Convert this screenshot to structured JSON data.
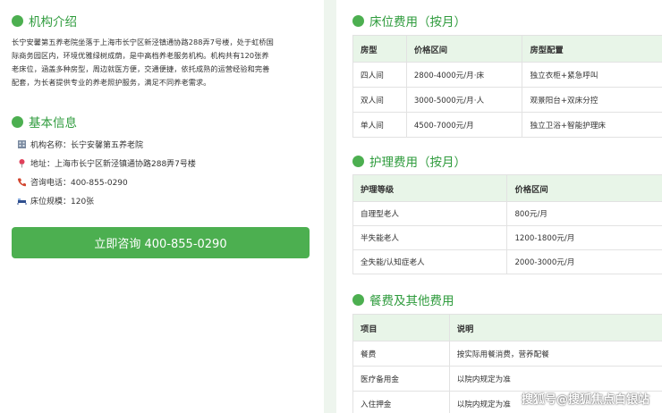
{
  "left": {
    "intro_section": {
      "title": "机构介绍",
      "lines": [
        "长宁安馨第五养老院坐落于上海市长宁区新泾镇通协路288弄7号楼，处于虹桥国",
        "际商务园区内，环境优雅绿树成荫，是中高档养老服务机构。机构共有120张养",
        "老床位，涵盖多种房型，周边就医方便，交通便捷，依托成熟的运营经验和完善",
        "配套，为长者提供专业的养老照护服务，满足不同养老需求。"
      ]
    },
    "basic_section": {
      "title": "基本信息",
      "rows": [
        {
          "icon": "building-icon",
          "text": "机构名称：长宁安馨第五养老院"
        },
        {
          "icon": "location-pin-icon",
          "text": "地址：上海市长宁区新泾镇通协路288弄7号楼"
        },
        {
          "icon": "phone-icon",
          "text": "咨询电话：400-855-0290"
        },
        {
          "icon": "bed-icon",
          "text": "床位规模：120张"
        }
      ]
    },
    "cta_label": "立即咨询 400-855-0290"
  },
  "right": {
    "bed_fees": {
      "title": "床位费用（按月）",
      "headers": [
        "房型",
        "价格区间",
        "房型配置"
      ],
      "rows": [
        [
          "四人间",
          "2800-4000元/月·床",
          "独立衣柜+紧急呼叫"
        ],
        [
          "双人间",
          "3000-5000元/月·人",
          "观景阳台+双床分控"
        ],
        [
          "单人间",
          "4500-7000元/月",
          "独立卫浴+智能护理床"
        ]
      ]
    },
    "care_fees": {
      "title": "护理费用（按月）",
      "headers": [
        "护理等级",
        "价格区间"
      ],
      "rows": [
        [
          "自理型老人",
          "800元/月"
        ],
        [
          "半失能老人",
          "1200-1800元/月"
        ],
        [
          "全失能/认知症老人",
          "2000-3000元/月"
        ]
      ]
    },
    "other_fees": {
      "title": "餐费及其他费用",
      "headers": [
        "项目",
        "说明"
      ],
      "rows": [
        [
          "餐费",
          "按实际用餐消费，营养配餐"
        ],
        [
          "医疗备用金",
          "以院内规定为准"
        ],
        [
          "入住押金",
          "以院内规定为准"
        ]
      ]
    }
  },
  "watermark": "搜狐号@搜狐焦点白银站",
  "colors": {
    "accent": "#4caf50",
    "title_green": "#2e9b3c",
    "header_bg": "#e8f5e8",
    "divider_bg": "#eef5ee"
  }
}
